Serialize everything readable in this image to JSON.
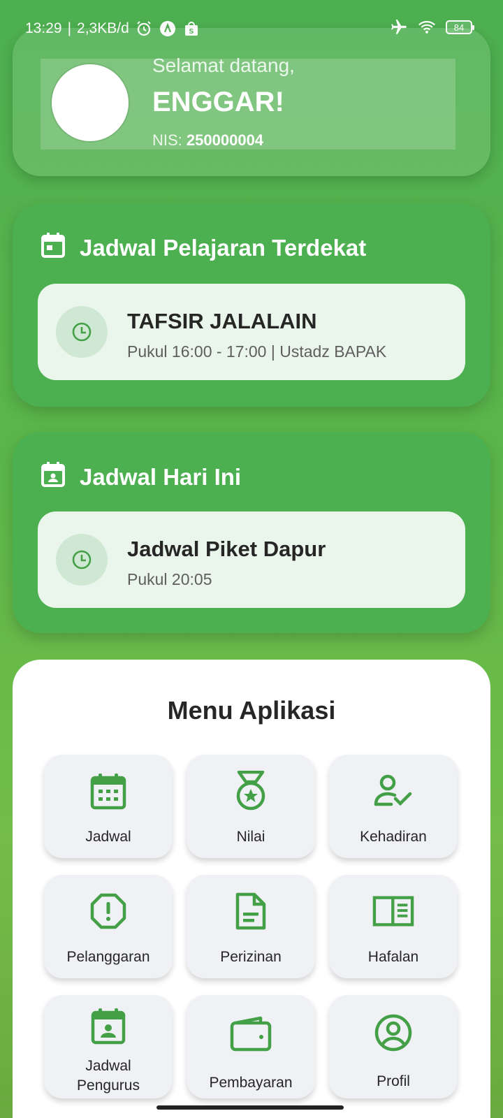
{
  "status_bar": {
    "time": "13:29",
    "net_speed": "2,3KB/d",
    "battery": "84",
    "icons": [
      "alarm-icon",
      "app-icon",
      "shop-icon",
      "airplane-icon",
      "wifi-icon",
      "battery-icon"
    ]
  },
  "header": {
    "greeting": "Selamat datang,",
    "name": "ENGGAR!",
    "nis_label": "NIS:",
    "nis_value": "250000004"
  },
  "nearest_schedule": {
    "title": "Jadwal Pelajaran Terdekat",
    "item_title": "TAFSIR JALALAIN",
    "item_sub": "Pukul 16:00 - 17:00 | Ustadz BAPAK"
  },
  "today_schedule": {
    "title": "Jadwal Hari Ini",
    "item_title": "Jadwal Piket Dapur",
    "item_sub": "Pukul 20:05"
  },
  "menu": {
    "title": "Menu Aplikasi",
    "items": [
      {
        "label": "Jadwal",
        "icon": "calendar-icon"
      },
      {
        "label": "Nilai",
        "icon": "medal-icon"
      },
      {
        "label": "Kehadiran",
        "icon": "user-check-icon"
      },
      {
        "label": "Pelanggaran",
        "icon": "warning-octagon-icon"
      },
      {
        "label": "Perizinan",
        "icon": "document-icon"
      },
      {
        "label": "Hafalan",
        "icon": "book-icon"
      },
      {
        "label": "Jadwal Pengurus",
        "icon": "calendar-person-icon"
      },
      {
        "label": "Pembayaran",
        "icon": "wallet-icon"
      },
      {
        "label": "Profil",
        "icon": "profile-icon"
      }
    ]
  },
  "colors": {
    "primary": "#4caf50",
    "icon_green": "#43a047",
    "card_light": "#eaf5ec",
    "tile_bg": "#eff1f5"
  }
}
